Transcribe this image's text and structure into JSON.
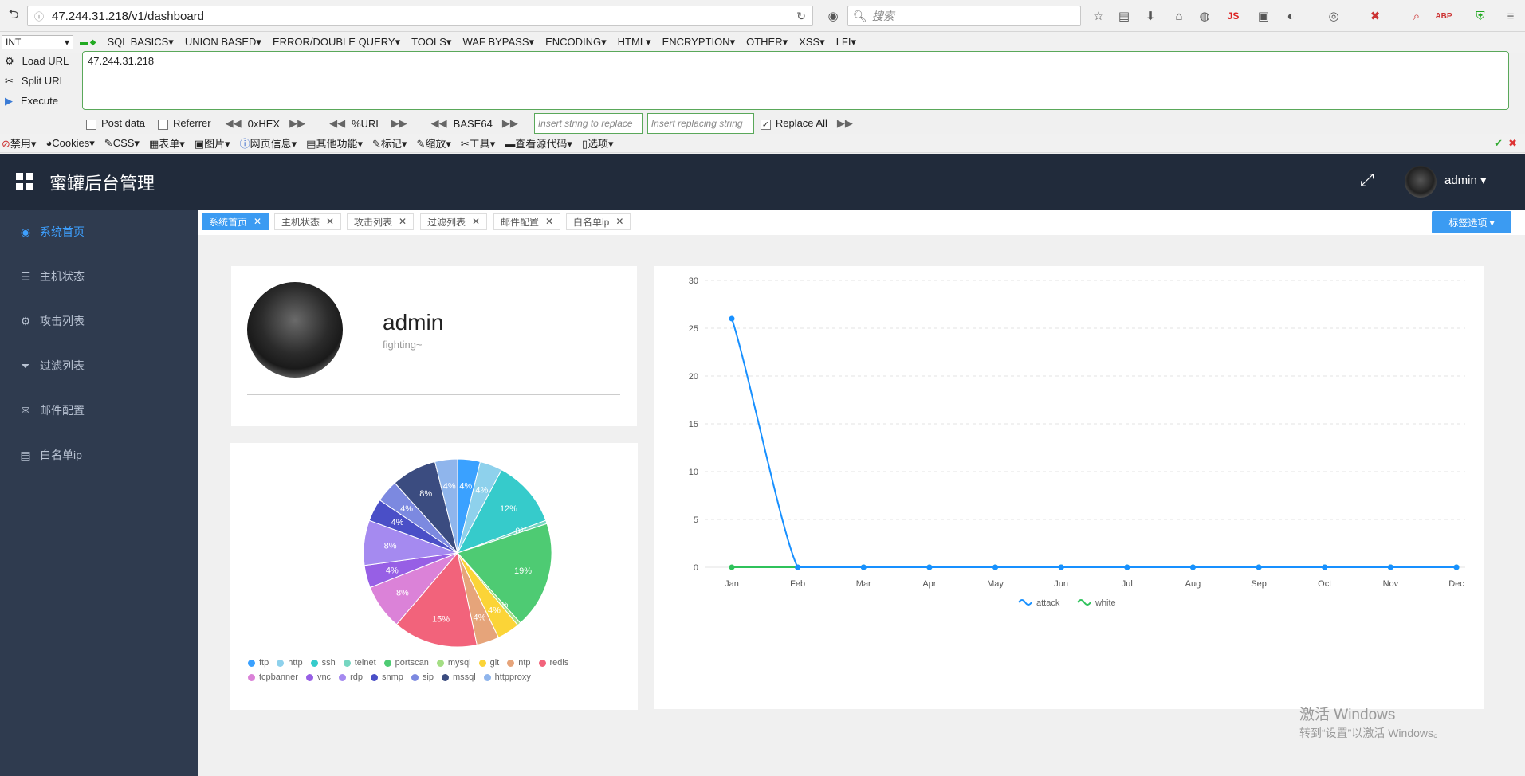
{
  "browser": {
    "url": "47.244.31.218/v1/dashboard",
    "search_placeholder": "搜索",
    "hackbar": {
      "select_value": "INT",
      "menus": [
        "SQL BASICS▾",
        "UNION BASED▾",
        "ERROR/DOUBLE QUERY▾",
        "TOOLS▾",
        "WAF BYPASS▾",
        "ENCODING▾",
        "HTML▾",
        "ENCRYPTION▾",
        "OTHER▾",
        "XSS▾",
        "LFI▾"
      ],
      "load_url": "Load URL",
      "split_url": "Split URL",
      "execute": "Execute",
      "url_value": "47.244.31.218",
      "post_data": "Post data",
      "referrer": "Referrer",
      "hex": "0xHEX",
      "pct_url": "%URL",
      "base64": "BASE64",
      "insert_replace": "Insert string to replace",
      "insert_replacing": "Insert replacing string",
      "replace_all": "Replace All"
    },
    "webdev": [
      "禁用▾",
      "Cookies▾",
      "CSS▾",
      "表单▾",
      "图片▾",
      "网页信息▾",
      "其他功能▾",
      "标记▾",
      "缩放▾",
      "工具▾",
      "查看源代码▾",
      "选项▾"
    ]
  },
  "app": {
    "title": "蜜罐后台管理",
    "user": "admin ▾",
    "sidebar": [
      {
        "label": "系统首页",
        "icon": "dashboard-icon",
        "active": true
      },
      {
        "label": "主机状态",
        "icon": "server-icon",
        "active": false
      },
      {
        "label": "攻击列表",
        "icon": "gear-icon",
        "active": false
      },
      {
        "label": "过滤列表",
        "icon": "filter-icon",
        "active": false
      },
      {
        "label": "邮件配置",
        "icon": "mail-icon",
        "active": false
      },
      {
        "label": "白名单ip",
        "icon": "list-icon",
        "active": false
      }
    ],
    "tabs": [
      {
        "label": "系统首页",
        "active": true
      },
      {
        "label": "主机状态",
        "active": false
      },
      {
        "label": "攻击列表",
        "active": false
      },
      {
        "label": "过滤列表",
        "active": false
      },
      {
        "label": "邮件配置",
        "active": false
      },
      {
        "label": "白名单ip",
        "active": false
      }
    ],
    "tag_options": "标签选项 ▾",
    "profile": {
      "name": "admin",
      "motto": "fighting~"
    }
  },
  "chart_data": [
    {
      "type": "pie",
      "categories": [
        "ftp",
        "http",
        "ssh",
        "telnet",
        "portscan",
        "mysql",
        "git",
        "ntp",
        "redis",
        "tcpbanner",
        "vnc",
        "rdp",
        "snmp",
        "sip",
        "mssql",
        "httpproxy"
      ],
      "values": [
        4,
        4,
        12,
        0,
        19,
        0,
        4,
        4,
        15,
        8,
        4,
        8,
        4,
        4,
        8,
        4
      ],
      "labels": [
        "4%",
        "4%",
        "12%",
        "0%",
        "19%",
        "0%",
        "4%",
        "4%",
        "15%",
        "8%",
        "4%",
        "8%",
        "4%",
        "4%",
        "8%",
        "4%"
      ],
      "colors": [
        "#3aa1ff",
        "#8ed1ec",
        "#36cbcb",
        "#76d6c1",
        "#4ecb73",
        "#a4de84",
        "#fbd437",
        "#e6a47a",
        "#f2637b",
        "#db82d8",
        "#975fe5",
        "#a58af0",
        "#4a4fc7",
        "#7c89e0",
        "#3b4c80",
        "#8fb5ec"
      ]
    },
    {
      "type": "line",
      "categories": [
        "Jan",
        "Feb",
        "Mar",
        "Apr",
        "May",
        "Jun",
        "Jul",
        "Aug",
        "Sep",
        "Oct",
        "Nov",
        "Dec"
      ],
      "series": [
        {
          "name": "attack",
          "values": [
            26,
            0,
            0,
            0,
            0,
            0,
            0,
            0,
            0,
            0,
            0,
            0
          ],
          "color": "#1890ff"
        },
        {
          "name": "white",
          "values": [
            0,
            0,
            0,
            0,
            0,
            0,
            0,
            0,
            0,
            0,
            0,
            0
          ],
          "color": "#2fc25b"
        }
      ],
      "yticks": [
        "0",
        "5",
        "10",
        "15",
        "20",
        "25",
        "30"
      ],
      "ylim": [
        0,
        30
      ],
      "legend": "bottom"
    }
  ],
  "watermark": {
    "line1": "激活 Windows",
    "line2": "转到“设置”以激活 Windows。"
  }
}
